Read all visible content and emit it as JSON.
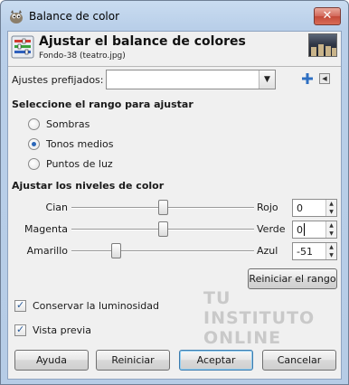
{
  "window": {
    "title": "Balance de color",
    "close_label": "✕"
  },
  "header": {
    "title": "Ajustar el balance de colores",
    "subtitle": "Fondo-38 (teatro.jpg)"
  },
  "presets": {
    "label": "Ajustes prefijados:",
    "value": ""
  },
  "range": {
    "title": "Seleccione el rango para ajustar",
    "options": [
      {
        "label": "Sombras",
        "selected": false
      },
      {
        "label": "Tonos medios",
        "selected": true
      },
      {
        "label": "Puntos de luz",
        "selected": false
      }
    ]
  },
  "levels": {
    "title": "Ajustar los niveles de color",
    "sliders": [
      {
        "left": "Cian",
        "right": "Rojo",
        "value": "0",
        "level": 0
      },
      {
        "left": "Magenta",
        "right": "Verde",
        "value": "0",
        "level": 0
      },
      {
        "left": "Amarillo",
        "right": "Azul",
        "value": "-51",
        "level": -51
      }
    ],
    "range_min": -100,
    "range_max": 100,
    "reset_range_label": "Reiniciar el rango"
  },
  "options": {
    "preserve_luminosity": {
      "label": "Conservar la luminosidad",
      "checked": true
    },
    "preview": {
      "label": "Vista previa",
      "checked": true
    }
  },
  "buttons": {
    "help": "Ayuda",
    "reset": "Reiniciar",
    "ok": "Aceptar",
    "cancel": "Cancelar"
  },
  "watermark": [
    "TU",
    "INSTITUTO",
    "ONLINE"
  ],
  "icons": {
    "app": "gimp-icon",
    "header": "color-balance-icon",
    "add": "plus-icon",
    "menu": "menu-arrow-icon"
  },
  "colors": {
    "accent": "#2b67b9",
    "title_bar": "#b9cfe9",
    "close": "#c44a3a"
  }
}
